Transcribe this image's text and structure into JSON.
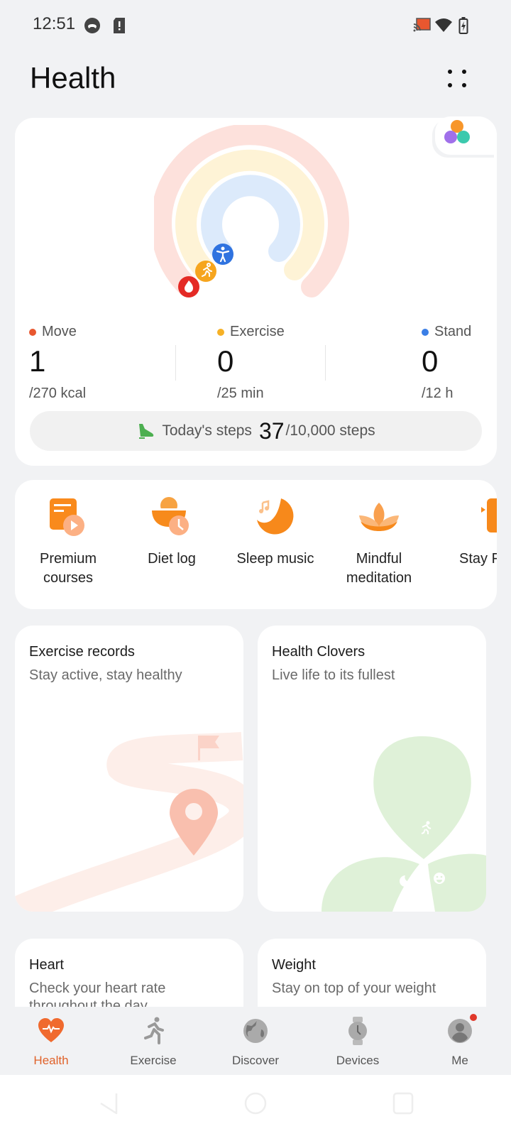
{
  "status_bar": {
    "time": "12:51",
    "left_icons": [
      "game-controller-icon",
      "sd-card-alert-icon"
    ],
    "right_icons": [
      "cast-icon",
      "wifi-icon",
      "battery-charging-icon"
    ]
  },
  "header": {
    "title": "Health",
    "more_icon": "more-dots-icon"
  },
  "activity": {
    "move": {
      "label": "Move",
      "value": "1",
      "goal": "/270 kcal",
      "color": "#e8572f",
      "progress": 0.0037
    },
    "exercise": {
      "label": "Exercise",
      "value": "0",
      "goal": "/25 min",
      "color": "#f6b126",
      "progress": 0
    },
    "stand": {
      "label": "Stand",
      "value": "0",
      "goal": "/12 h",
      "color": "#3b7fe6",
      "progress": 0
    },
    "steps": {
      "label": "Today's steps",
      "value": "37",
      "goal": "/10,000 steps"
    }
  },
  "services": [
    {
      "label": "Premium\ncourses",
      "icon": "video-course-icon"
    },
    {
      "label": "Diet log",
      "icon": "diet-bowl-icon"
    },
    {
      "label": "Sleep music",
      "icon": "sleep-moon-music-icon"
    },
    {
      "label": "Mindful\nmeditation",
      "icon": "lotus-icon"
    },
    {
      "label": "Stay Fi",
      "icon": "stay-fit-icon"
    }
  ],
  "tiles": [
    {
      "title": "Exercise records",
      "subtitle": "Stay active, stay healthy"
    },
    {
      "title": "Health Clovers",
      "subtitle": "Live life to its fullest"
    },
    {
      "title": "Heart",
      "subtitle": "Check your heart rate throughout the day"
    },
    {
      "title": "Weight",
      "subtitle": "Stay on top of your weight"
    }
  ],
  "bottom_nav": [
    {
      "label": "Health",
      "active": true
    },
    {
      "label": "Exercise",
      "active": false
    },
    {
      "label": "Discover",
      "active": false
    },
    {
      "label": "Devices",
      "active": false
    },
    {
      "label": "Me",
      "active": false,
      "badge": true
    }
  ],
  "colors": {
    "accent": "#e0622a",
    "background": "#f1f2f4"
  }
}
